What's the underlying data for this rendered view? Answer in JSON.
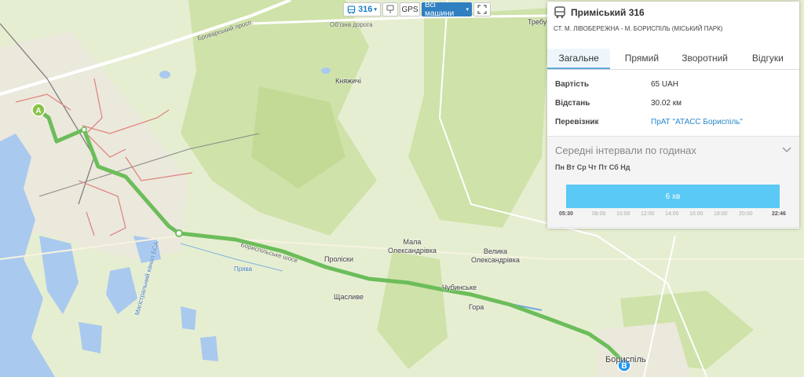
{
  "toolbar": {
    "route_number": "316",
    "gps_label": "GPS",
    "vehicles_label": "Всі машини"
  },
  "map": {
    "labels": {
      "brovarskyi": "Броварський просп.",
      "obizna": "Об'їзна дорога",
      "trebu": "Требу",
      "kniazhychi": "Княжичі",
      "mala": "Мала\nОлександрівка",
      "velyka": "Велика\nОлександрівка",
      "proliski": "Проліски",
      "chubynske": "Чубинське",
      "gora": "Гора",
      "shchaslyve": "Щасливе",
      "boryspil": "Бориспіль",
      "priava": "Прява",
      "kanal": "Магістральний канал БСА",
      "hwy": "Бориспільське шосе"
    },
    "marker_a": "A",
    "marker_b": "B"
  },
  "panel": {
    "title": "Приміський 316",
    "subtitle": "СТ. М. ЛІВОБЕРЕЖНА - М. БОРИСПІЛЬ (МІСЬКИЙ ПАРК)",
    "tabs": [
      "Загальне",
      "Прямий",
      "Зворотний",
      "Відгуки"
    ],
    "active_tab": 0,
    "info": {
      "cost_label": "Вартість",
      "cost_value": "65 UAH",
      "distance_label": "Відстань",
      "distance_value": "30.02 км",
      "carrier_label": "Перевізник",
      "carrier_value": "ПрАТ \"АТАСС Бориспіль\""
    },
    "intervals": {
      "title": "Середні інтервали по годинах",
      "days": "Пн Вт Ср Чт Пт Сб Нд",
      "bar_label": "6 хв",
      "ticks": [
        "05:30",
        "08:00",
        "10:00",
        "12:00",
        "14:00",
        "16:00",
        "18:00",
        "20:00",
        "22:46"
      ]
    }
  },
  "colors": {
    "route": "#6cbd5a",
    "accent": "#2f7fc1",
    "bar": "#5bc9f5"
  }
}
